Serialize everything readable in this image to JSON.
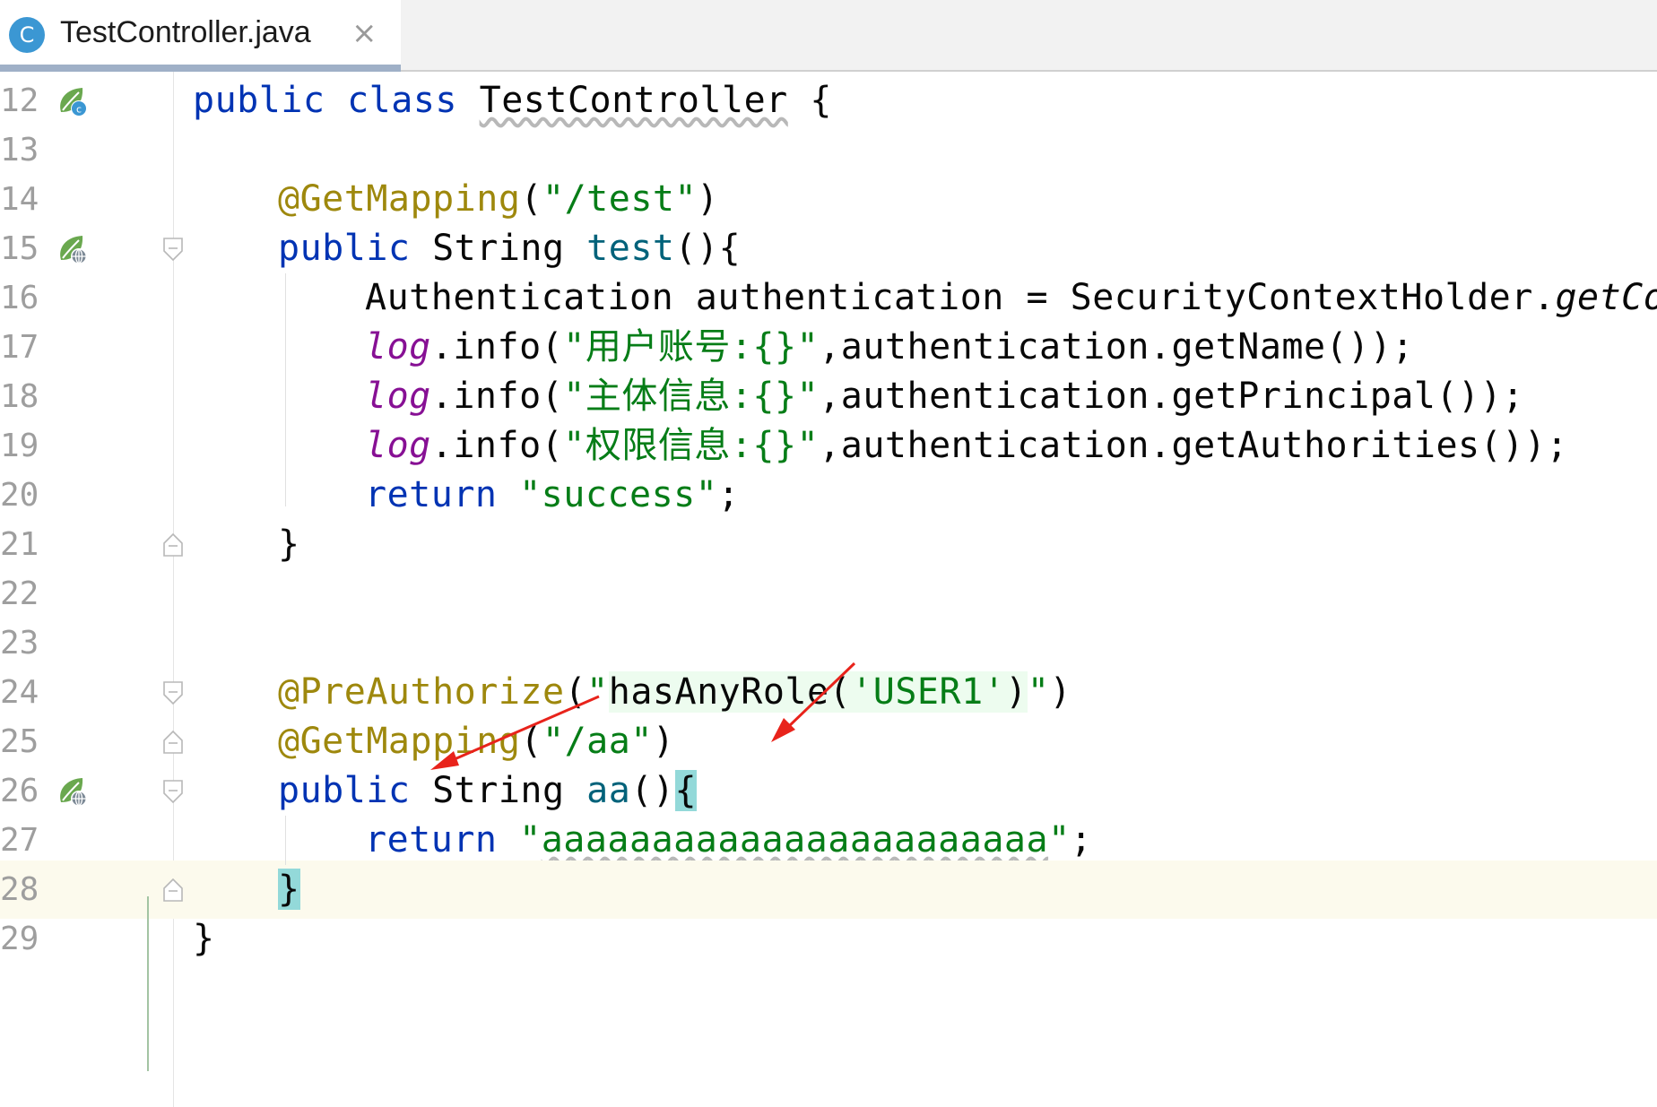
{
  "tab": {
    "icon_letter": "C",
    "title": "TestController.java",
    "close_symbol": "×",
    "close_icon": "close-icon",
    "file_icon": "java-class-icon"
  },
  "gutter": {
    "line_numbers": [
      "12",
      "13",
      "14",
      "15",
      "16",
      "17",
      "18",
      "19",
      "20",
      "21",
      "22",
      "23",
      "24",
      "25",
      "26",
      "27",
      "28",
      "29"
    ],
    "current_line": "28",
    "icons": {
      "12": "spring-bean-class-icon",
      "15": "spring-web-endpoint-icon",
      "26": "spring-web-endpoint-icon"
    }
  },
  "code": {
    "l12": {
      "kw1": "public",
      "kw2": "class",
      "name": "TestController",
      "brace": " {"
    },
    "l14": {
      "ann": "@GetMapping",
      "open": "(",
      "str": "\"/test\"",
      "close": ")"
    },
    "l15": {
      "kw": "public",
      "type": " String ",
      "fn": "test",
      "rest": "(){"
    },
    "l16": {
      "text": "Authentication authentication = SecurityContextHolder.",
      "italic": "getCon"
    },
    "l17": {
      "log": "log",
      "mid": ".info(",
      "str": "\"用户账号:{}\"",
      "rest": ",authentication.getName());"
    },
    "l18": {
      "log": "log",
      "mid": ".info(",
      "str": "\"主体信息:{}\"",
      "rest": ",authentication.getPrincipal());"
    },
    "l19": {
      "log": "log",
      "mid": ".info(",
      "str": "\"权限信息:{}\"",
      "rest": ",authentication.getAuthorities());"
    },
    "l20": {
      "kw": "return",
      "str": "\"success\"",
      "rest": ";"
    },
    "l21": {
      "brace": "}"
    },
    "l24": {
      "ann": "@PreAuthorize",
      "open": "(",
      "q1": "\"",
      "expr": "hasAnyRole(",
      "role": "'USER1'",
      "expr_end": ")",
      "q2": "\"",
      "close": ")"
    },
    "l25": {
      "ann": "@GetMapping",
      "open": "(",
      "str": "\"/aa\"",
      "close": ")"
    },
    "l26": {
      "kw": "public",
      "type": " String ",
      "fn": "aa",
      "paren": "()",
      "brace": "{"
    },
    "l27": {
      "kw": "return",
      "q1": "\"",
      "str": "aaaaaaaaaaaaaaaaaaaaaaa",
      "q2": "\"",
      "rest": ";"
    },
    "l28": {
      "brace": "}"
    },
    "l29": {
      "brace": "}"
    }
  },
  "colors": {
    "keyword": "#0033b3",
    "annotation": "#9e880d",
    "string": "#067d17",
    "function": "#00627a",
    "static_field": "#871094",
    "arrow": "#e8231b"
  }
}
